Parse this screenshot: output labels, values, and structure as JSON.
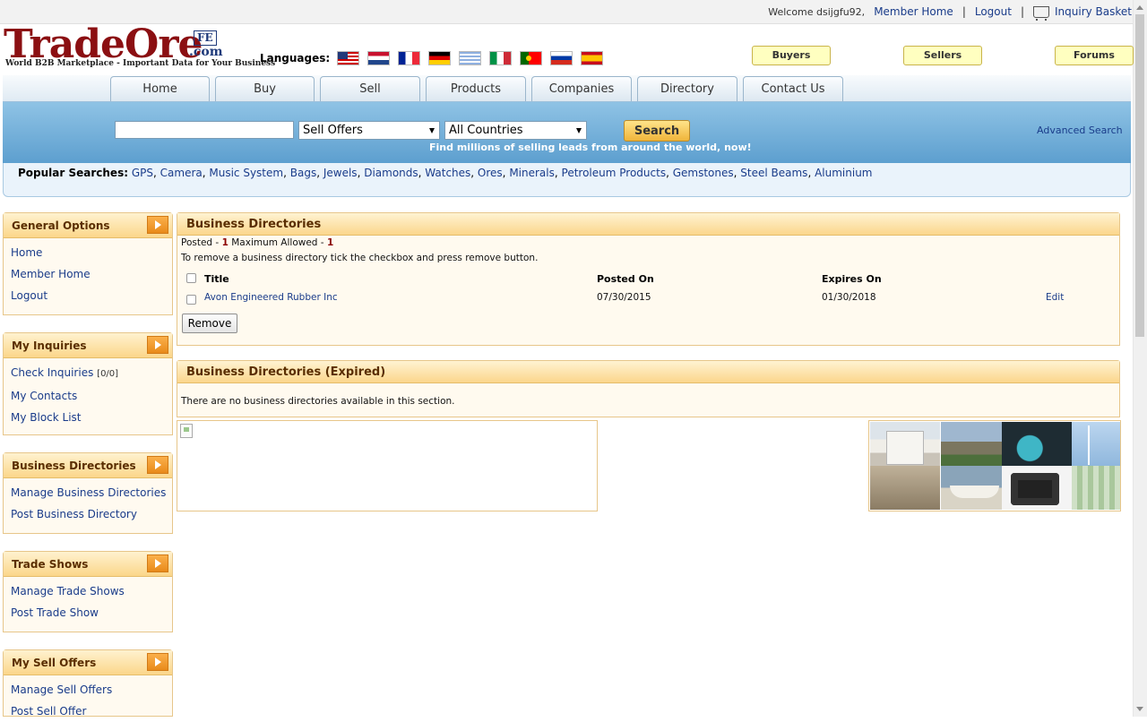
{
  "topbar": {
    "welcome": "Welcome dsijgfu92,",
    "member_home": "Member Home",
    "logout": "Logout",
    "inquiry_basket": "Inquiry Basket"
  },
  "logo": {
    "name": "TradeOre",
    "badge": "FE",
    "domain": ".com",
    "tagline": "World B2B Marketplace - Important Data for Your Business"
  },
  "languages": {
    "label": "Languages:",
    "flags": [
      "us-flag-icon",
      "netherlands-flag-icon",
      "france-flag-icon",
      "germany-flag-icon",
      "greece-flag-icon",
      "italy-flag-icon",
      "portugal-flag-icon",
      "russia-flag-icon",
      "spain-flag-icon"
    ]
  },
  "header_buttons": {
    "buyers": "Buyers",
    "sellers": "Sellers",
    "forums": "Forums"
  },
  "nav": {
    "tabs": [
      "Home",
      "Buy",
      "Sell",
      "Products",
      "Companies",
      "Directory",
      "Contact Us"
    ]
  },
  "search": {
    "query": "",
    "type_selected": "Sell Offers",
    "country_selected": "All Countries",
    "button": "Search",
    "tagline": "Find millions of selling leads from around the world, now!",
    "advanced": "Advanced Search"
  },
  "popular": {
    "label": "Popular Searches:",
    "items": [
      "GPS",
      "Camera",
      "Music System",
      "Bags",
      "Jewels",
      "Diamonds",
      "Watches",
      "Ores",
      "Minerals",
      "Petroleum Products",
      "Gemstones",
      "Steel Beams",
      "Aluminium"
    ]
  },
  "sidebar": {
    "general": {
      "title": "General Options",
      "items": [
        "Home",
        "Member Home",
        "Logout"
      ]
    },
    "inquiries": {
      "title": "My Inquiries",
      "items": [
        "Check Inquiries",
        "My Contacts",
        "My Block List"
      ],
      "count": "[0/0]"
    },
    "business": {
      "title": "Business Directories",
      "items": [
        "Manage Business Directories",
        "Post Business Directory"
      ]
    },
    "trade": {
      "title": "Trade Shows",
      "items": [
        "Manage Trade Shows",
        "Post Trade Show"
      ]
    },
    "sell": {
      "title": "My Sell Offers",
      "items": [
        "Manage Sell Offers",
        "Post Sell Offer"
      ]
    }
  },
  "directories": {
    "title": "Business Directories",
    "posted_label": "Posted -",
    "posted_value": "1",
    "max_label": "Maximum Allowed -",
    "max_value": "1",
    "instruction": "To remove a business directory tick the checkbox and press remove button.",
    "columns": {
      "title": "Title",
      "posted_on": "Posted On",
      "expires_on": "Expires On"
    },
    "rows": [
      {
        "title": "Avon Engineered Rubber Inc",
        "posted_on": "07/30/2015",
        "expires_on": "01/30/2018",
        "action": "Edit"
      }
    ],
    "remove_button": "Remove"
  },
  "expired": {
    "title": "Business Directories (Expired)",
    "message": "There are no business directories available in this section."
  },
  "colors": {
    "brand_red": "#8b0f12",
    "link_blue": "#1a3c8a",
    "panel_header": "#fbd68a",
    "search_band": "#5d9fcf"
  }
}
